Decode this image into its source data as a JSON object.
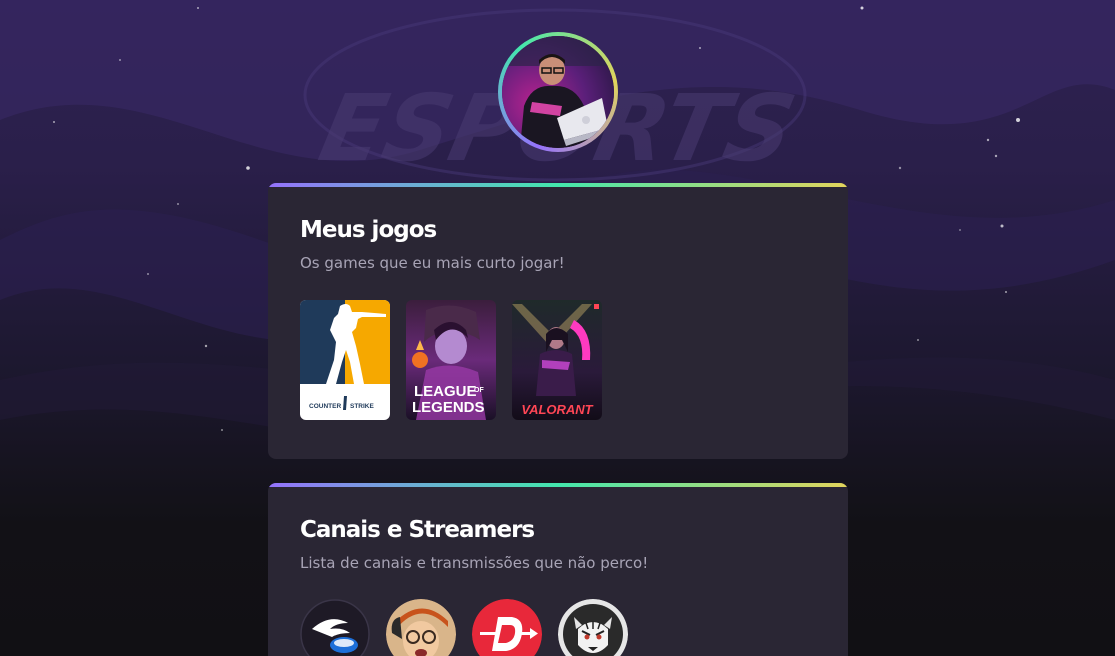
{
  "background": {
    "watermark": "ESPORTS"
  },
  "profile": {
    "avatar_alt": "avatar"
  },
  "games_section": {
    "title": "Meus jogos",
    "subtitle": "Os games que eu mais curto jogar!",
    "games": [
      {
        "name": "Counter-Strike",
        "logo_line1": "COUNTER",
        "logo_line2": "STRIKE"
      },
      {
        "name": "League of Legends",
        "logo_line1": "LEAGUE",
        "logo_of": "OF",
        "logo_line2": "LEGENDS"
      },
      {
        "name": "Valorant",
        "logo": "VALORANT"
      }
    ]
  },
  "channels_section": {
    "title": "Canais e Streamers",
    "subtitle": "Lista de canais e transmissões que não perco!"
  },
  "colors": {
    "accent_gradient": [
      "#9572fc",
      "#43e7ad",
      "#e2d45c"
    ],
    "card_bg": "#2a2634",
    "text_primary": "#ffffff",
    "text_secondary": "#a8a4b6"
  }
}
